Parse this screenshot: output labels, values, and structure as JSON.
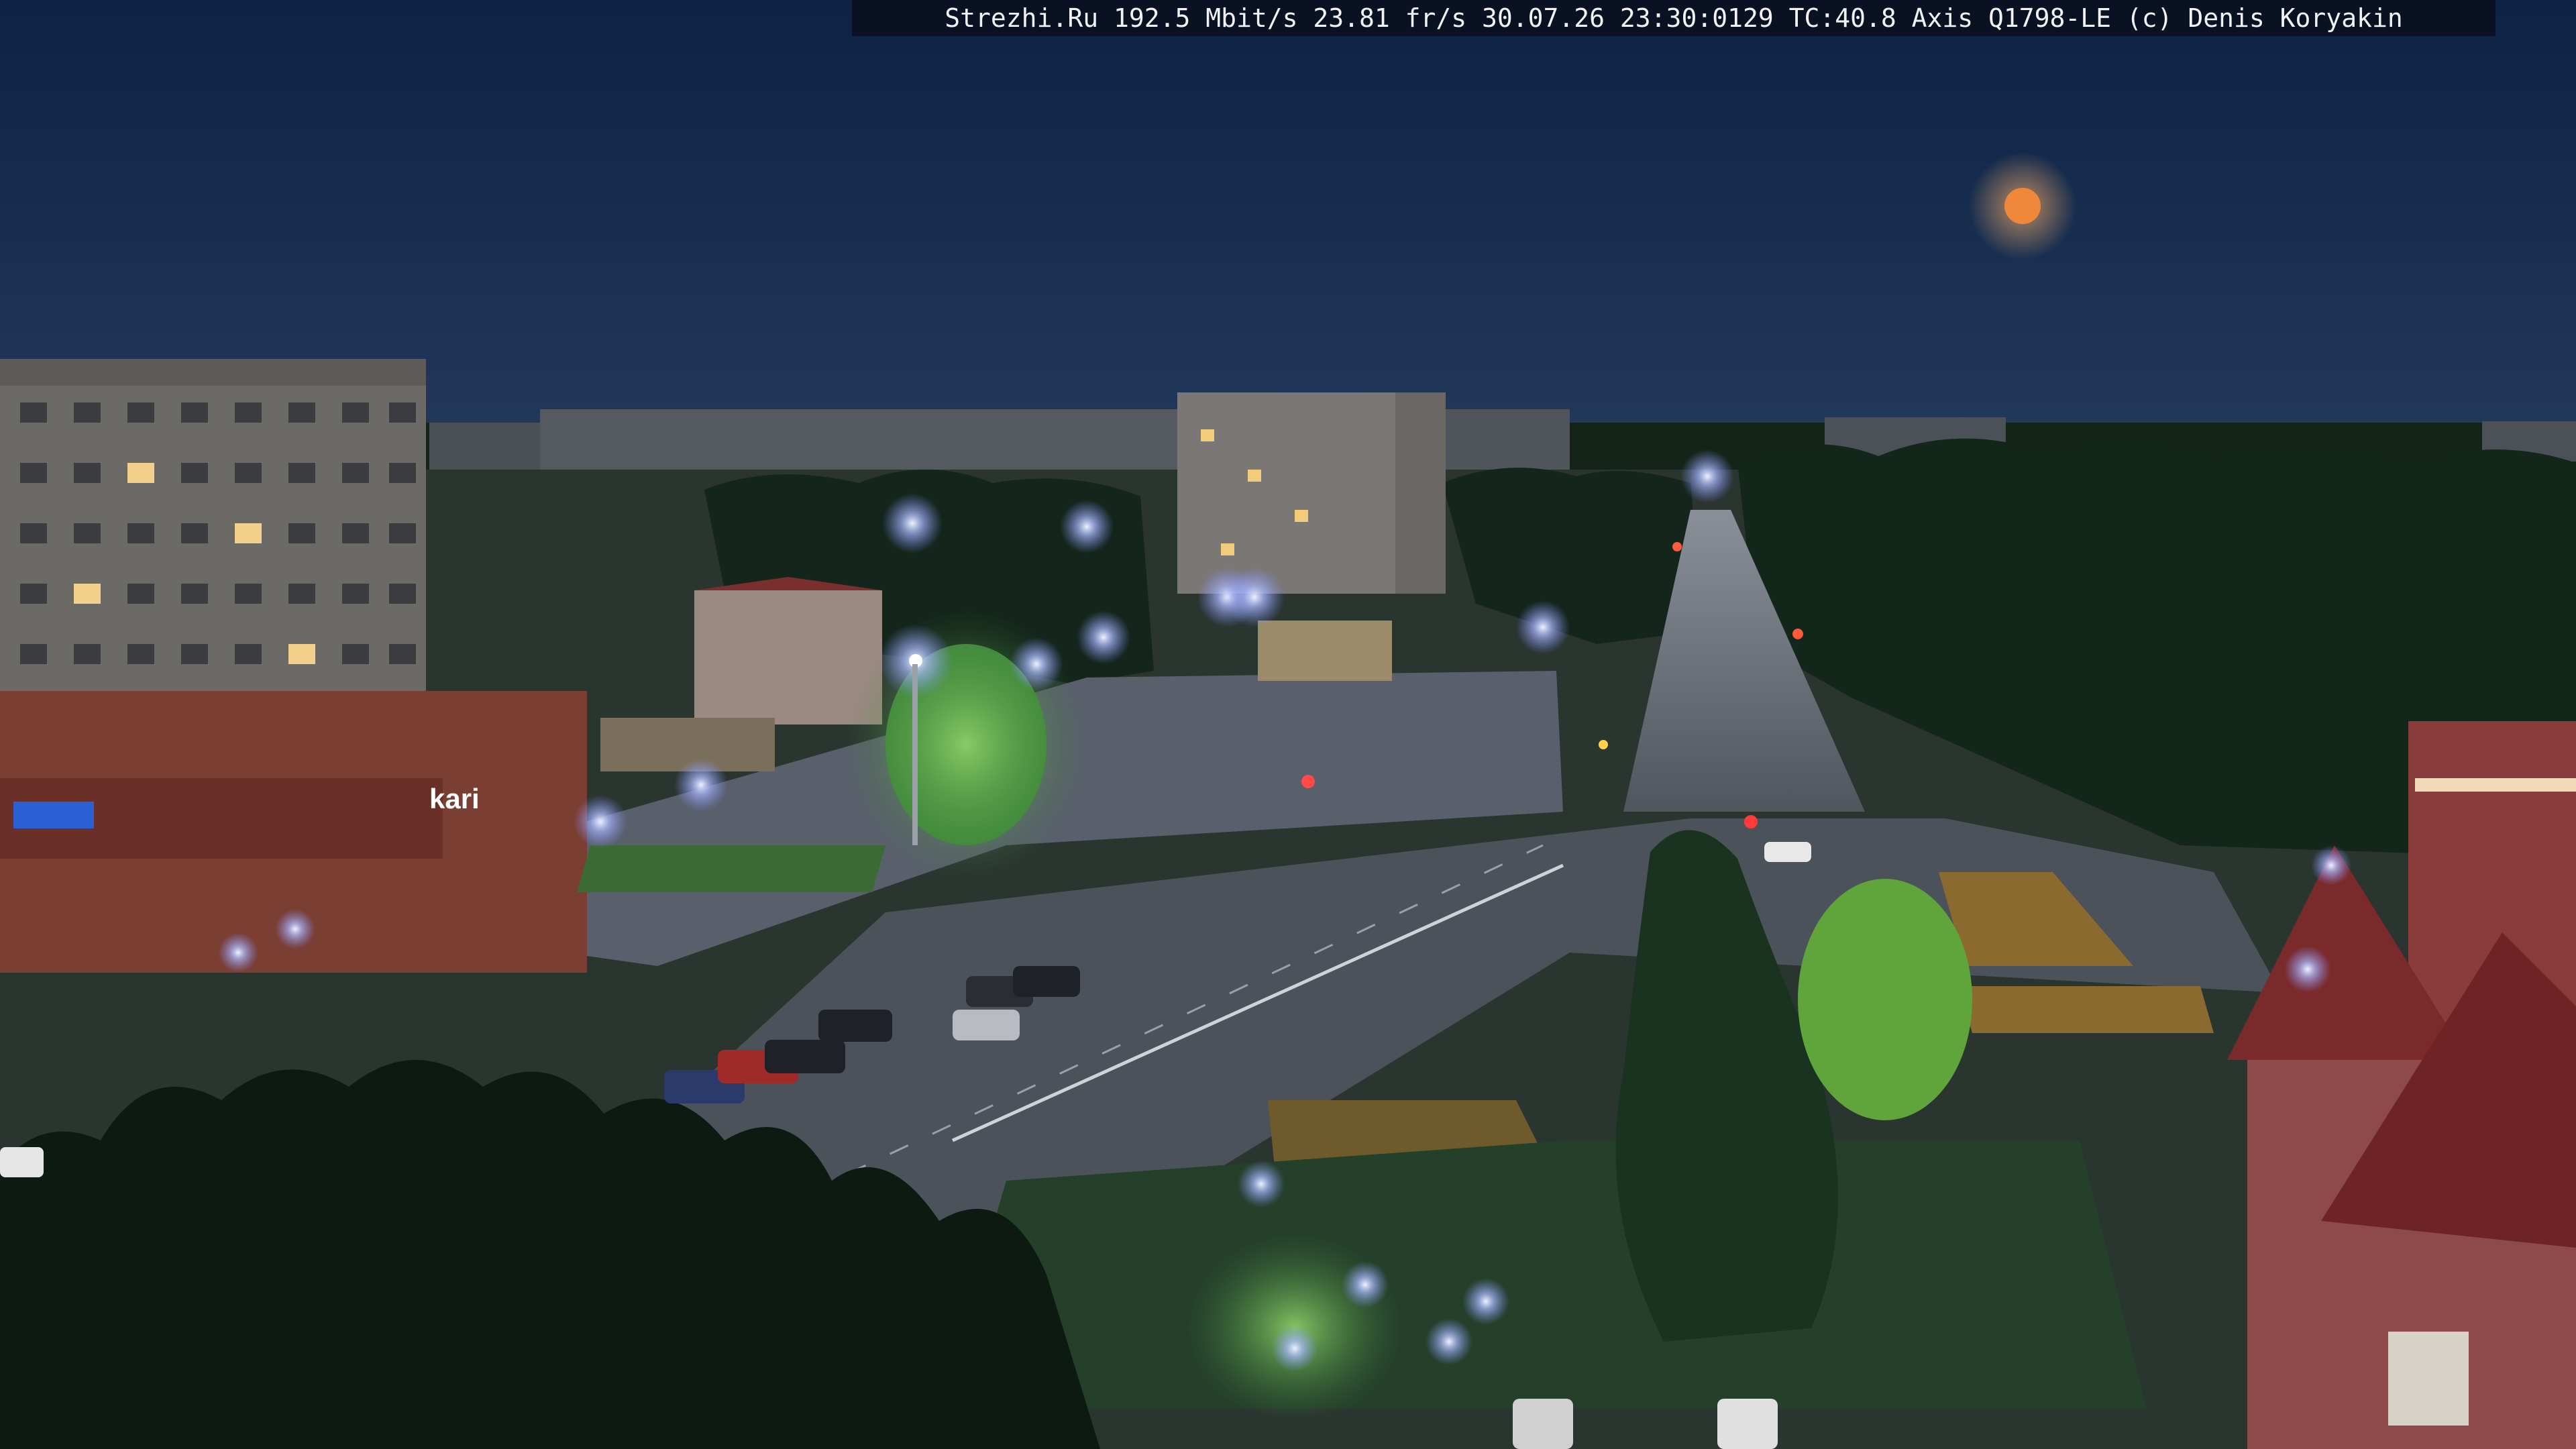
{
  "overlay": {
    "text": "Strezhi.Ru 192.5 Mbit/s 23.81 fr/s 30.07.26 23:30:0129 TC:40.8  Axis Q1798-LE  (c) Denis Koryakin"
  },
  "shop_sign": {
    "brand": "kari"
  },
  "colors": {
    "sky_top": "#0d2244",
    "sky_horizon": "#20395c",
    "moon": "#f0883a",
    "trees": "#0f1f18",
    "street_light": "#c8d8ff",
    "plaza": "#59606b"
  }
}
